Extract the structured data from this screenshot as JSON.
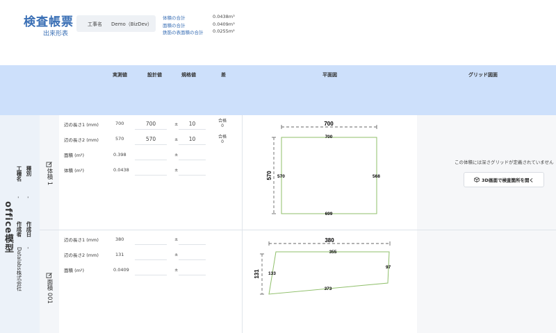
{
  "header": {
    "title": "検査帳票",
    "subtitle": "出来形表",
    "project_label": "工事名",
    "project_value": "Demo（BizDev）",
    "summary": [
      {
        "label": "体積の合計",
        "value": "0.0438m³"
      },
      {
        "label": "面積の合計",
        "value": "0.0409m³"
      },
      {
        "label": "鉄筋の表面積の合計",
        "value": "0.0255m²"
      }
    ]
  },
  "table_header": {
    "actual": "実測値",
    "design": "設計値",
    "standard": "規格値",
    "diff": "差",
    "plan": "平面図",
    "grid": "グリッド図面"
  },
  "left_panel": {
    "model_name": "office模型",
    "kind_label": "種別",
    "kind_value": "-",
    "project_label": "工種名",
    "project_value": "-",
    "date_label": "作成日",
    "date_value": "-",
    "author_label": "作成者",
    "author_value": "Datalabs株式会社"
  },
  "rows": [
    {
      "label": "体積 1",
      "fields": [
        {
          "name": "辺の長さ1 (mm)",
          "actual": "700",
          "design": "700",
          "pm": "±",
          "tolerance": "10",
          "result": "合格",
          "diff": "0"
        },
        {
          "name": "辺の長さ2 (mm)",
          "actual": "570",
          "design": "570",
          "pm": "±",
          "tolerance": "10",
          "result": "合格",
          "diff": "0"
        },
        {
          "name": "面積 (m²)",
          "actual": "0.398",
          "design": "",
          "pm": "±",
          "tolerance": "",
          "result": "",
          "diff": ""
        },
        {
          "name": "体積 (m³)",
          "actual": "0.0438",
          "design": "",
          "pm": "±",
          "tolerance": "",
          "result": "",
          "diff": ""
        }
      ],
      "plan": {
        "dim_top": "700",
        "dim_left": "570",
        "edge_top": "700",
        "edge_left": "570",
        "edge_right": "568",
        "edge_bottom": "699"
      }
    },
    {
      "label": "面積 001",
      "fields": [
        {
          "name": "辺の長さ1 (mm)",
          "actual": "380",
          "design": "",
          "pm": "±",
          "tolerance": ""
        },
        {
          "name": "辺の長さ2 (mm)",
          "actual": "131",
          "design": "",
          "pm": "±",
          "tolerance": ""
        },
        {
          "name": "面積 (m²)",
          "actual": "0.0409",
          "design": "",
          "pm": "±",
          "tolerance": ""
        }
      ],
      "plan": {
        "dim_top": "380",
        "dim_left": "131",
        "edge_top": "355",
        "edge_left": "133",
        "edge_right": "97",
        "edge_bottom": "373"
      }
    }
  ],
  "grid_panel": {
    "message": "この体積には深さグリッドが定義されていません",
    "button_label": "3D画面で検査箇所を開く",
    "button_icon": "cube-icon"
  },
  "colors": {
    "accent": "#3a6fb5",
    "header_bg": "#cde0fb",
    "shape_stroke": "#8fbf6a"
  }
}
